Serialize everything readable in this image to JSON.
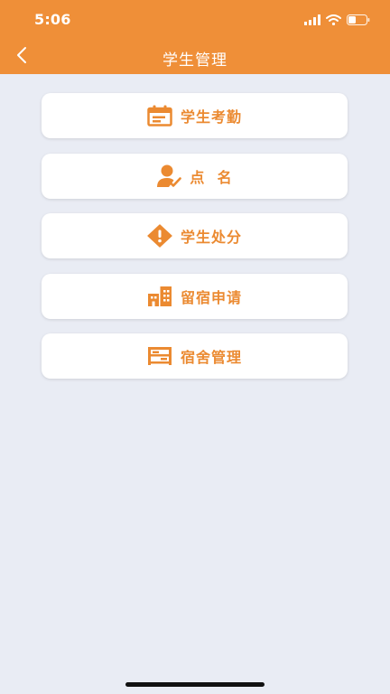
{
  "status_bar": {
    "time": "5:06"
  },
  "navbar": {
    "title": "学生管理",
    "back_icon": "chevron-left-icon"
  },
  "menu": {
    "items": [
      {
        "label": "学生考勤",
        "icon": "attendance-calendar-icon"
      },
      {
        "label": "点  名",
        "icon": "roll-call-person-check-icon"
      },
      {
        "label": "学生处分",
        "icon": "warning-diamond-icon"
      },
      {
        "label": "留宿申请",
        "icon": "buildings-icon"
      },
      {
        "label": "宿舍管理",
        "icon": "dormitory-bed-icon"
      }
    ]
  },
  "colors": {
    "brand": "#EF8F38",
    "accent_text": "#EB8A31",
    "background": "#E9ECF4"
  }
}
